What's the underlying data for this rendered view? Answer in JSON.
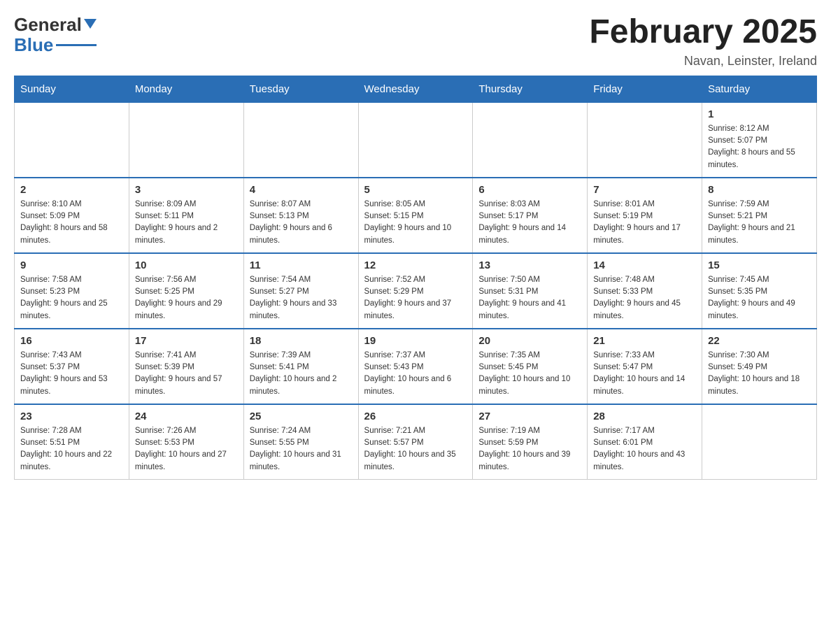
{
  "header": {
    "logo_general": "General",
    "logo_blue": "Blue",
    "month_title": "February 2025",
    "location": "Navan, Leinster, Ireland"
  },
  "days_of_week": [
    "Sunday",
    "Monday",
    "Tuesday",
    "Wednesday",
    "Thursday",
    "Friday",
    "Saturday"
  ],
  "weeks": [
    [
      {
        "day": "",
        "sunrise": "",
        "sunset": "",
        "daylight": ""
      },
      {
        "day": "",
        "sunrise": "",
        "sunset": "",
        "daylight": ""
      },
      {
        "day": "",
        "sunrise": "",
        "sunset": "",
        "daylight": ""
      },
      {
        "day": "",
        "sunrise": "",
        "sunset": "",
        "daylight": ""
      },
      {
        "day": "",
        "sunrise": "",
        "sunset": "",
        "daylight": ""
      },
      {
        "day": "",
        "sunrise": "",
        "sunset": "",
        "daylight": ""
      },
      {
        "day": "1",
        "sunrise": "Sunrise: 8:12 AM",
        "sunset": "Sunset: 5:07 PM",
        "daylight": "Daylight: 8 hours and 55 minutes."
      }
    ],
    [
      {
        "day": "2",
        "sunrise": "Sunrise: 8:10 AM",
        "sunset": "Sunset: 5:09 PM",
        "daylight": "Daylight: 8 hours and 58 minutes."
      },
      {
        "day": "3",
        "sunrise": "Sunrise: 8:09 AM",
        "sunset": "Sunset: 5:11 PM",
        "daylight": "Daylight: 9 hours and 2 minutes."
      },
      {
        "day": "4",
        "sunrise": "Sunrise: 8:07 AM",
        "sunset": "Sunset: 5:13 PM",
        "daylight": "Daylight: 9 hours and 6 minutes."
      },
      {
        "day": "5",
        "sunrise": "Sunrise: 8:05 AM",
        "sunset": "Sunset: 5:15 PM",
        "daylight": "Daylight: 9 hours and 10 minutes."
      },
      {
        "day": "6",
        "sunrise": "Sunrise: 8:03 AM",
        "sunset": "Sunset: 5:17 PM",
        "daylight": "Daylight: 9 hours and 14 minutes."
      },
      {
        "day": "7",
        "sunrise": "Sunrise: 8:01 AM",
        "sunset": "Sunset: 5:19 PM",
        "daylight": "Daylight: 9 hours and 17 minutes."
      },
      {
        "day": "8",
        "sunrise": "Sunrise: 7:59 AM",
        "sunset": "Sunset: 5:21 PM",
        "daylight": "Daylight: 9 hours and 21 minutes."
      }
    ],
    [
      {
        "day": "9",
        "sunrise": "Sunrise: 7:58 AM",
        "sunset": "Sunset: 5:23 PM",
        "daylight": "Daylight: 9 hours and 25 minutes."
      },
      {
        "day": "10",
        "sunrise": "Sunrise: 7:56 AM",
        "sunset": "Sunset: 5:25 PM",
        "daylight": "Daylight: 9 hours and 29 minutes."
      },
      {
        "day": "11",
        "sunrise": "Sunrise: 7:54 AM",
        "sunset": "Sunset: 5:27 PM",
        "daylight": "Daylight: 9 hours and 33 minutes."
      },
      {
        "day": "12",
        "sunrise": "Sunrise: 7:52 AM",
        "sunset": "Sunset: 5:29 PM",
        "daylight": "Daylight: 9 hours and 37 minutes."
      },
      {
        "day": "13",
        "sunrise": "Sunrise: 7:50 AM",
        "sunset": "Sunset: 5:31 PM",
        "daylight": "Daylight: 9 hours and 41 minutes."
      },
      {
        "day": "14",
        "sunrise": "Sunrise: 7:48 AM",
        "sunset": "Sunset: 5:33 PM",
        "daylight": "Daylight: 9 hours and 45 minutes."
      },
      {
        "day": "15",
        "sunrise": "Sunrise: 7:45 AM",
        "sunset": "Sunset: 5:35 PM",
        "daylight": "Daylight: 9 hours and 49 minutes."
      }
    ],
    [
      {
        "day": "16",
        "sunrise": "Sunrise: 7:43 AM",
        "sunset": "Sunset: 5:37 PM",
        "daylight": "Daylight: 9 hours and 53 minutes."
      },
      {
        "day": "17",
        "sunrise": "Sunrise: 7:41 AM",
        "sunset": "Sunset: 5:39 PM",
        "daylight": "Daylight: 9 hours and 57 minutes."
      },
      {
        "day": "18",
        "sunrise": "Sunrise: 7:39 AM",
        "sunset": "Sunset: 5:41 PM",
        "daylight": "Daylight: 10 hours and 2 minutes."
      },
      {
        "day": "19",
        "sunrise": "Sunrise: 7:37 AM",
        "sunset": "Sunset: 5:43 PM",
        "daylight": "Daylight: 10 hours and 6 minutes."
      },
      {
        "day": "20",
        "sunrise": "Sunrise: 7:35 AM",
        "sunset": "Sunset: 5:45 PM",
        "daylight": "Daylight: 10 hours and 10 minutes."
      },
      {
        "day": "21",
        "sunrise": "Sunrise: 7:33 AM",
        "sunset": "Sunset: 5:47 PM",
        "daylight": "Daylight: 10 hours and 14 minutes."
      },
      {
        "day": "22",
        "sunrise": "Sunrise: 7:30 AM",
        "sunset": "Sunset: 5:49 PM",
        "daylight": "Daylight: 10 hours and 18 minutes."
      }
    ],
    [
      {
        "day": "23",
        "sunrise": "Sunrise: 7:28 AM",
        "sunset": "Sunset: 5:51 PM",
        "daylight": "Daylight: 10 hours and 22 minutes."
      },
      {
        "day": "24",
        "sunrise": "Sunrise: 7:26 AM",
        "sunset": "Sunset: 5:53 PM",
        "daylight": "Daylight: 10 hours and 27 minutes."
      },
      {
        "day": "25",
        "sunrise": "Sunrise: 7:24 AM",
        "sunset": "Sunset: 5:55 PM",
        "daylight": "Daylight: 10 hours and 31 minutes."
      },
      {
        "day": "26",
        "sunrise": "Sunrise: 7:21 AM",
        "sunset": "Sunset: 5:57 PM",
        "daylight": "Daylight: 10 hours and 35 minutes."
      },
      {
        "day": "27",
        "sunrise": "Sunrise: 7:19 AM",
        "sunset": "Sunset: 5:59 PM",
        "daylight": "Daylight: 10 hours and 39 minutes."
      },
      {
        "day": "28",
        "sunrise": "Sunrise: 7:17 AM",
        "sunset": "Sunset: 6:01 PM",
        "daylight": "Daylight: 10 hours and 43 minutes."
      },
      {
        "day": "",
        "sunrise": "",
        "sunset": "",
        "daylight": ""
      }
    ]
  ]
}
